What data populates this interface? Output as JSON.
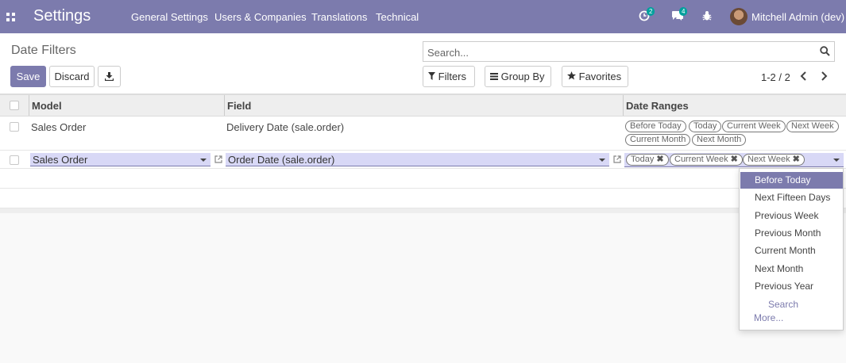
{
  "navbar": {
    "app_title": "Settings",
    "menus": [
      "General Settings",
      "Users & Companies",
      "Translations",
      "Technical"
    ],
    "activity_count": "2",
    "messages_count": "4",
    "user_name": "Mitchell Admin (dev)",
    "accent_color": "#7c7bad"
  },
  "control_panel": {
    "breadcrumb": "Date Filters",
    "save_label": "Save",
    "discard_label": "Discard",
    "search_placeholder": "Search...",
    "filters_label": "Filters",
    "group_by_label": "Group By",
    "favorites_label": "Favorites",
    "pager": "1-2 / 2"
  },
  "table": {
    "headers": [
      "Model",
      "Field",
      "Date Ranges"
    ],
    "rows": [
      {
        "model": "Sales Order",
        "field": "Delivery Date (sale.order)",
        "date_ranges": [
          "Before Today",
          "Today",
          "Current Week",
          "Next Week",
          "Current Month",
          "Next Month"
        ]
      },
      {
        "model": "Sales Order",
        "field": "Order Date (sale.order)",
        "date_ranges": [
          "Today",
          "Current Week",
          "Next Week"
        ],
        "editing": true
      }
    ]
  },
  "dropdown": {
    "items": [
      "Before Today",
      "Next Fifteen Days",
      "Previous Week",
      "Previous Month",
      "Current Month",
      "Next Month",
      "Previous Year"
    ],
    "active_item": "Before Today",
    "search_label": "Search",
    "more_label": "More..."
  }
}
